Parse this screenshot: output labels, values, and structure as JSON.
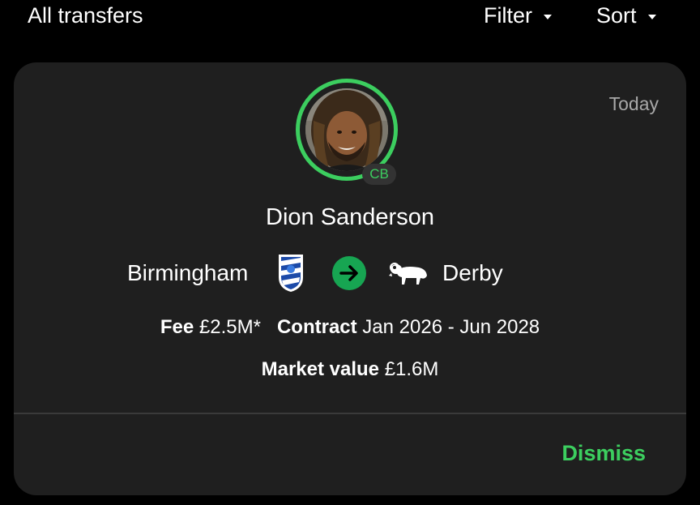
{
  "header": {
    "title": "All transfers",
    "filter_label": "Filter",
    "sort_label": "Sort"
  },
  "transfer": {
    "date": "Today",
    "player_name": "Dion Sanderson",
    "position": "CB",
    "from_club": "Birmingham",
    "to_club": "Derby",
    "fee_label": "Fee",
    "fee_value": "£2.5M*",
    "contract_label": "Contract",
    "contract_value": "Jan 2026 - Jun 2028",
    "market_value_label": "Market value",
    "market_value": "£1.6M",
    "dismiss_label": "Dismiss"
  },
  "icons": {
    "from_crest": "birmingham-crest-icon",
    "transfer_arrow": "arrow-right-icon",
    "to_crest": "derby-crest-icon",
    "filter_caret": "caret-down-icon",
    "sort_caret": "caret-down-icon"
  },
  "colors": {
    "background": "#000000",
    "card": "#1f1f1f",
    "accent_green": "#3cce5f",
    "arrow_green": "#17a552",
    "muted_text": "#a8a8a8"
  }
}
